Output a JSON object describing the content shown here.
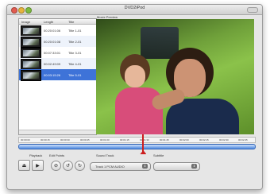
{
  "window": {
    "title": "DVD2iPod"
  },
  "list": {
    "columns": {
      "image": "Image",
      "length": "Length",
      "title": "Title"
    },
    "rows": [
      {
        "length": "00:20:01:06",
        "title": "Title 1-01"
      },
      {
        "length": "00:20:01:08",
        "title": "Title 2-01"
      },
      {
        "length": "00:07:33:01",
        "title": "Title 3-01"
      },
      {
        "length": "00:02:49:09",
        "title": "Title 4-01"
      },
      {
        "length": "00:03:15:26",
        "title": "Title 5-01"
      }
    ],
    "selected_index": 4
  },
  "preview": {
    "label": "Movie Preview"
  },
  "timeline": {
    "ticks": [
      "00:00:00",
      "00:00:15",
      "00:00:30",
      "00:00:45",
      "00:01:00",
      "00:01:15",
      "00:01:30",
      "00:01:45",
      "00:02:00",
      "00:02:15",
      "00:02:30",
      "00:02:45"
    ],
    "position": 0.53
  },
  "controls": {
    "playback_label": "Playback",
    "edit_points_label": "Edit Points",
    "sound_track_label": "Sound Track",
    "subtitle_label": "Subtitle",
    "sound_track_value": "Track 1 PCM AUDIO",
    "subtitle_value": ""
  },
  "icons": {
    "eject": "eject-icon",
    "play": "play-icon",
    "set-in": "set-in-point-icon",
    "set-out": "set-out-point-icon",
    "reset": "reset-icon"
  },
  "colors": {
    "selection": "#3e73d8",
    "playhead": "#cc1e1e",
    "scrub": "#4a86de"
  }
}
